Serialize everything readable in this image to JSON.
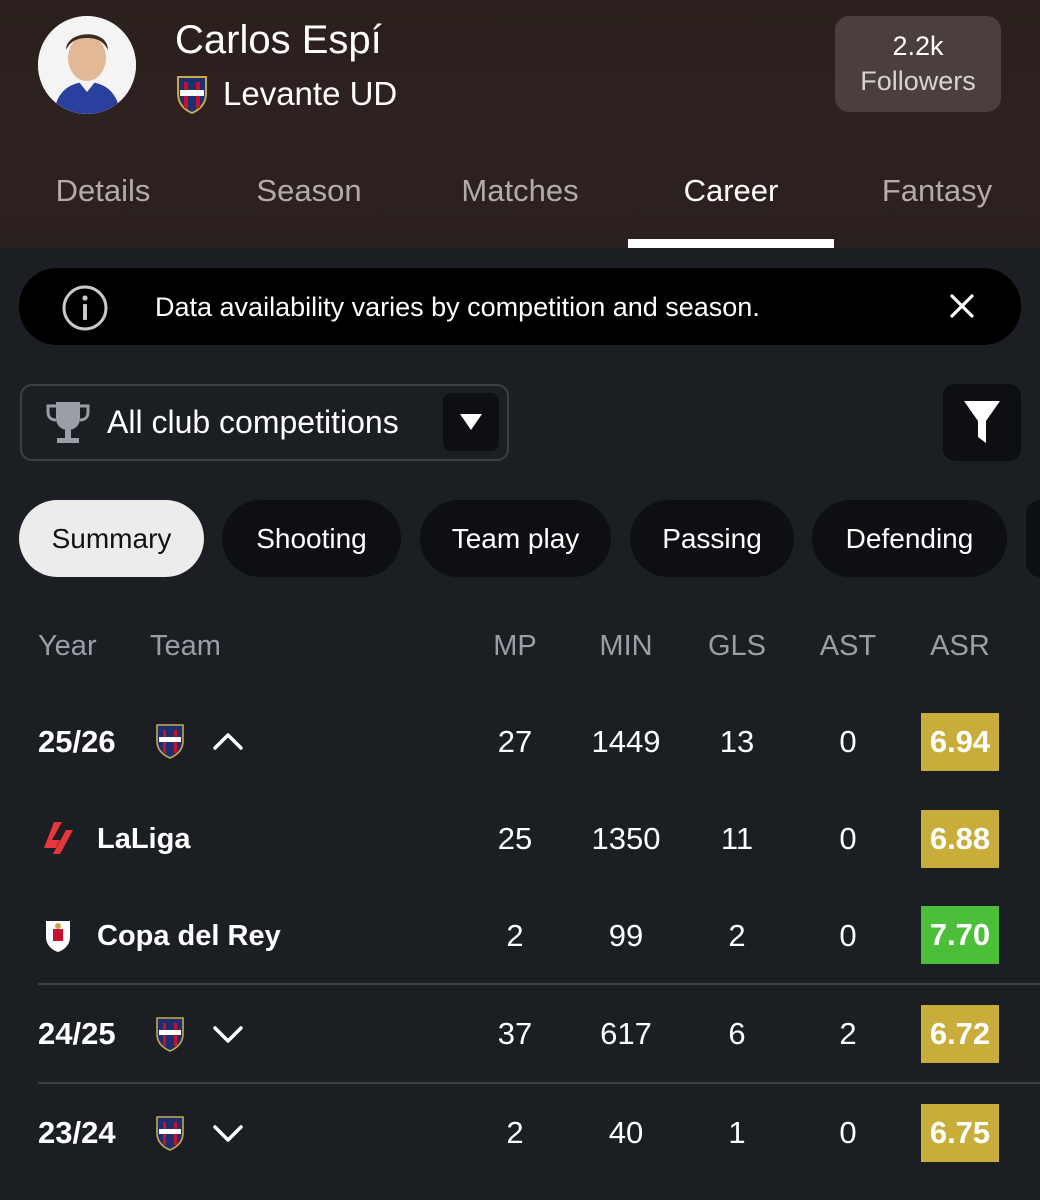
{
  "player": {
    "name": "Carlos Espí",
    "team": "Levante UD",
    "followers_count": "2.2k",
    "followers_label": "Followers"
  },
  "tabs": [
    {
      "label": "Details"
    },
    {
      "label": "Season"
    },
    {
      "label": "Matches"
    },
    {
      "label": "Career",
      "active": true
    },
    {
      "label": "Fantasy"
    }
  ],
  "banner": {
    "text": "Data availability varies by competition and season."
  },
  "competition_filter": {
    "selected": "All club competitions"
  },
  "stat_chips": [
    {
      "label": "Summary",
      "active": true
    },
    {
      "label": "Shooting"
    },
    {
      "label": "Team play"
    },
    {
      "label": "Passing"
    },
    {
      "label": "Defending"
    }
  ],
  "table": {
    "headers": {
      "year": "Year",
      "team": "Team",
      "mp": "MP",
      "min": "MIN",
      "gls": "GLS",
      "ast": "AST",
      "asr": "ASR"
    },
    "rows": [
      {
        "label": "25/26",
        "mp": "27",
        "min": "1449",
        "gls": "13",
        "ast": "0",
        "asr": "6.94",
        "asr_color": "#c9ad3a",
        "expanded": true
      },
      {
        "label": "LaLiga",
        "mp": "25",
        "min": "1350",
        "gls": "11",
        "ast": "0",
        "asr": "6.88",
        "asr_color": "#c9ad3a"
      },
      {
        "label": "Copa del Rey",
        "mp": "2",
        "min": "99",
        "gls": "2",
        "ast": "0",
        "asr": "7.70",
        "asr_color": "#4cbf3a"
      },
      {
        "label": "24/25",
        "mp": "37",
        "min": "617",
        "gls": "6",
        "ast": "2",
        "asr": "6.72",
        "asr_color": "#c9ad3a",
        "expanded": false
      },
      {
        "label": "23/24",
        "mp": "2",
        "min": "40",
        "gls": "1",
        "ast": "0",
        "asr": "6.75",
        "asr_color": "#c9ad3a",
        "expanded": false
      }
    ]
  },
  "colors": {
    "background": "#1b1e22",
    "header": "#2e2220",
    "asr_average": "#c9ad3a",
    "asr_good": "#4cbf3a",
    "laliga": "#e8373c"
  },
  "icons": {
    "team_crest": "levante-crest-icon",
    "info": "info-icon",
    "close": "close-icon",
    "trophy": "trophy-icon",
    "dropdown": "caret-down-icon",
    "filter": "filter-icon",
    "expand": "chevron-down-icon",
    "collapse": "chevron-up-icon"
  }
}
